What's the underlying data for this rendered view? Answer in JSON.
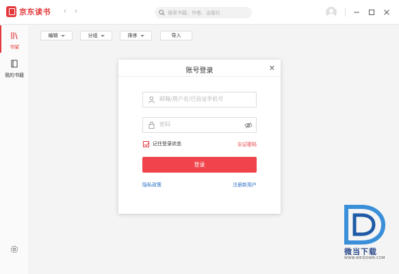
{
  "app": {
    "title": "京东读书"
  },
  "search": {
    "placeholder": "搜索书籍、作者、出版社",
    "icon": "search-icon"
  },
  "sidebar": {
    "items": [
      {
        "label": "书架",
        "icon": "bookshelf-icon",
        "active": true
      },
      {
        "label": "我的书籍",
        "icon": "book-icon",
        "active": false
      }
    ],
    "settings_icon": "gear-icon"
  },
  "toolbar": {
    "edit_label": "编辑",
    "group_label": "分组",
    "sort_label": "排序",
    "import_label": "导入"
  },
  "dialog": {
    "title": "账号登录",
    "username_placeholder": "邮箱/用户名/已验证手机号",
    "password_placeholder": "密码",
    "remember_label": "记住登录状态",
    "remember_checked": true,
    "forgot_label": "忘记密码",
    "login_label": "登录",
    "left_link": "隐私政策",
    "right_link": "注册新用户"
  },
  "watermark": {
    "text": "微当下载",
    "url": "WWW.WEIDOWN.COM"
  },
  "colors": {
    "brand": "#e4393c",
    "login_button": "#f0434b",
    "link": "#2b6fc4"
  }
}
